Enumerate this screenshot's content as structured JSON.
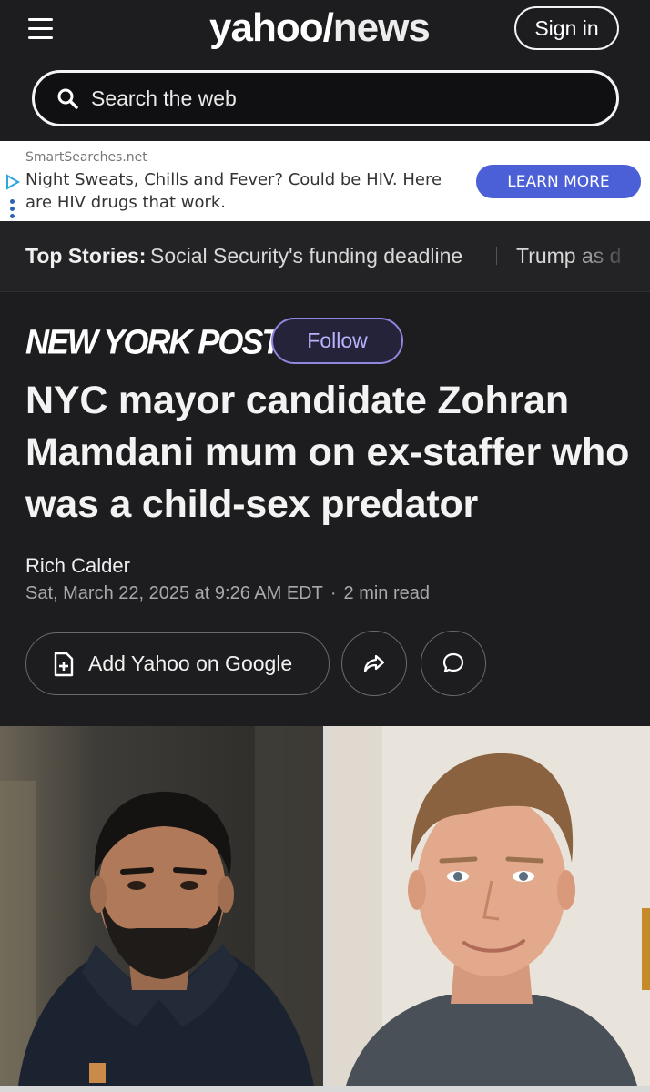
{
  "header": {
    "logo_part1": "yahoo/",
    "logo_part2": "news",
    "signin_label": "Sign in",
    "search_placeholder": "Search the web"
  },
  "ad": {
    "source": "SmartSearches.net",
    "text": "Night Sweats, Chills and Fever? Could be HIV. Here are HIV drugs that work.",
    "cta": "LEARN MORE"
  },
  "top_stories": {
    "label": "Top Stories:",
    "items": [
      "Social Security's funding deadline",
      "Trump as d"
    ]
  },
  "article": {
    "publisher": "NEW YORK POST",
    "follow_label": "Follow",
    "headline": "NYC mayor candidate Zohran Mamdani mum on ex-staffer who was a child-sex predator",
    "author": "Rich Calder",
    "date": "Sat, March 22, 2025 at 9:26 AM EDT",
    "read_time": "2 min read",
    "add_google_label": "Add Yahoo on Google"
  },
  "colors": {
    "background": "#1d1d1f",
    "follow_accent": "#8f86e0",
    "ad_button": "#4b5fd6"
  },
  "icons": [
    "menu-icon",
    "search-icon",
    "adchoices-icon",
    "add-document-icon",
    "share-icon",
    "comment-icon"
  ]
}
